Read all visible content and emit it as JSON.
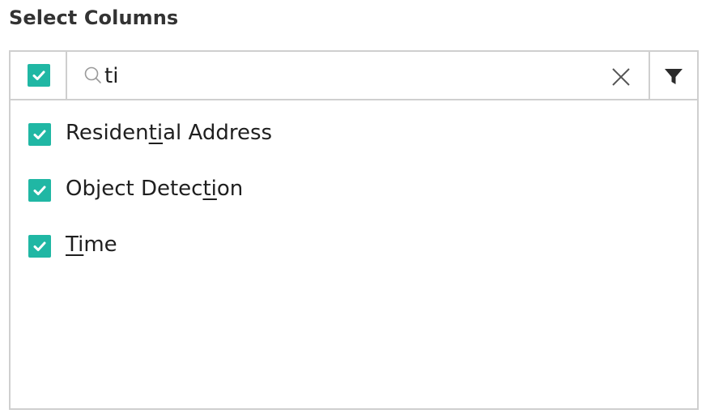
{
  "header": {
    "title": "Select Columns"
  },
  "toolbar": {
    "select_all_checked": true,
    "search": {
      "value": "ti",
      "placeholder": ""
    },
    "icons": {
      "search": "search-icon",
      "clear": "close-icon",
      "filter": "filter-icon"
    }
  },
  "items": [
    {
      "pre": "Residen",
      "match": "ti",
      "post": "al Address",
      "checked": true
    },
    {
      "pre": "Object Detec",
      "match": "ti",
      "post": "on",
      "checked": true
    },
    {
      "pre": "",
      "match": "Ti",
      "post": "me",
      "checked": true
    }
  ],
  "colors": {
    "accent": "#20b7a4",
    "border": "#cfcfcf",
    "title": "#333333"
  }
}
